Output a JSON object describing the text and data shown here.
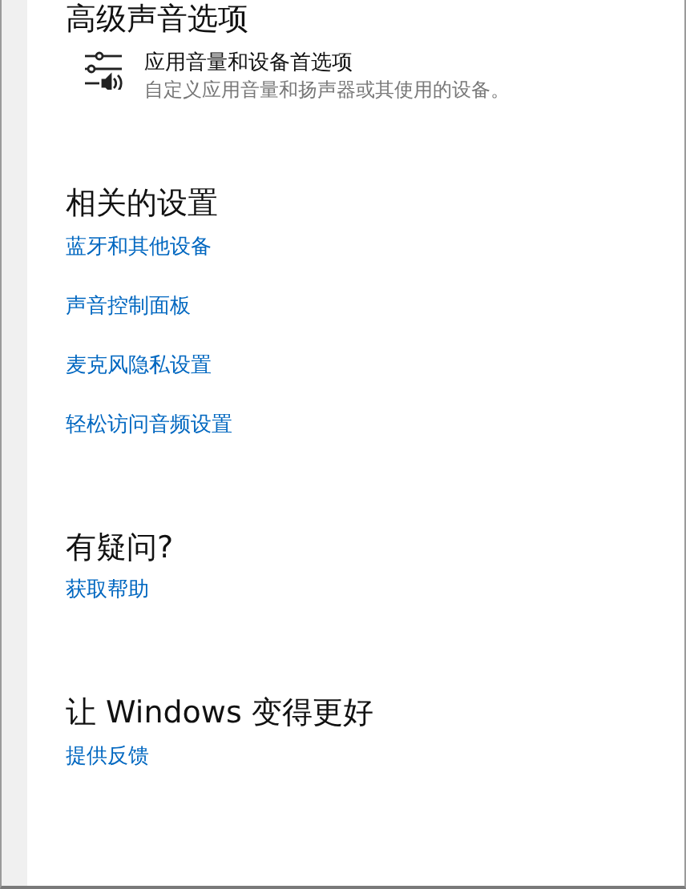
{
  "top_heading": "高级声音选项",
  "app_volume_option": {
    "title": "应用音量和设备首选项",
    "description": "自定义应用音量和扬声器或其使用的设备。"
  },
  "sections": [
    {
      "heading": "相关的设置",
      "links": [
        "蓝牙和其他设备",
        "声音控制面板",
        "麦克风隐私设置",
        "轻松访问音频设置"
      ]
    },
    {
      "heading": "有疑问?",
      "links": [
        "获取帮助"
      ]
    },
    {
      "heading": "让 Windows 变得更好",
      "links": [
        "提供反馈"
      ]
    }
  ]
}
